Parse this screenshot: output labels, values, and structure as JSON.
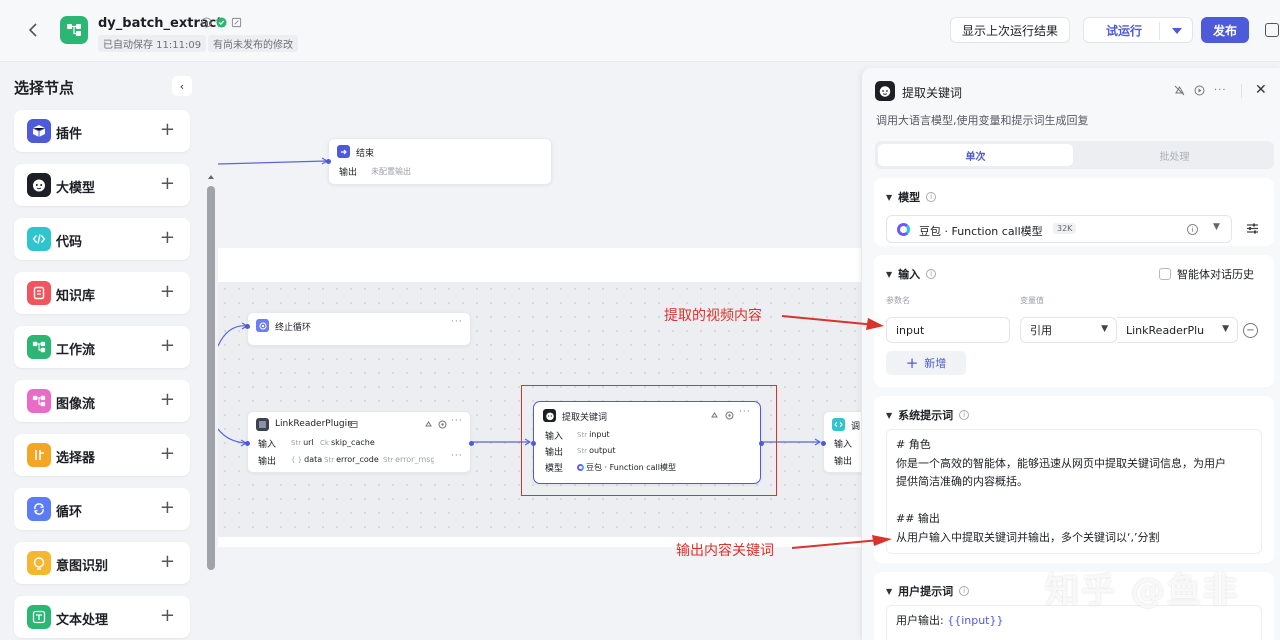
{
  "header": {
    "title": "dy_batch_extract",
    "save_status": "已自动保存 11:11:09",
    "unpublished": "有尚未发布的修改",
    "show_last_run": "显示上次运行结果",
    "test_run": "试运行",
    "publish": "发布"
  },
  "sidebar": {
    "title": "选择节点",
    "items": [
      {
        "label": "插件",
        "color": "#4e5bd8"
      },
      {
        "label": "大模型",
        "color": "#1d1f24"
      },
      {
        "label": "代码",
        "color": "#2ec5ce"
      },
      {
        "label": "知识库",
        "color": "#f0555f"
      },
      {
        "label": "工作流",
        "color": "#2bb673"
      },
      {
        "label": "图像流",
        "color": "#e86bc6"
      },
      {
        "label": "选择器",
        "color": "#f5a524"
      },
      {
        "label": "循环",
        "color": "#5b7cf6"
      },
      {
        "label": "意图识别",
        "color": "#f5b731"
      },
      {
        "label": "文本处理",
        "color": "#2bb673"
      }
    ]
  },
  "canvas": {
    "end_node": {
      "title": "结束",
      "output_label": "输出",
      "output_value": "未配置输出"
    },
    "stop_loop_node": {
      "title": "终止循环"
    },
    "plugin_node": {
      "title": "LinkReaderPlugin",
      "input_label": "输入",
      "output_label": "输出",
      "inputs": [
        {
          "type": "Str",
          "name": "url"
        },
        {
          "type": "Ck",
          "name": "skip_cache"
        }
      ],
      "outputs": [
        {
          "type": "{ }",
          "name": "data"
        },
        {
          "type": "Str",
          "name": "error_code"
        },
        {
          "type": "Str",
          "name": "error_msg"
        }
      ]
    },
    "llm_node": {
      "title": "提取关键词",
      "input_label": "输入",
      "output_label": "输出",
      "model_label": "模型",
      "input_tag": {
        "type": "Str",
        "name": "input"
      },
      "output_tag": {
        "type": "Str",
        "name": "output"
      },
      "model": "豆包 · Function call模型"
    },
    "code_node": {
      "title": "调",
      "input_label": "输入",
      "output_label": "输出"
    }
  },
  "panel": {
    "title": "提取关键词",
    "description": "调用大语言模型,使用变量和提示词生成回复",
    "tabs": {
      "single": "单次",
      "batch": "批处理"
    },
    "model_section": {
      "title": "模型",
      "model_name": "豆包 · Function call模型",
      "context": "32K"
    },
    "input_section": {
      "title": "输入",
      "history_label": "智能体对话历史",
      "param_col": "参数名",
      "value_col": "变量值",
      "param_name": "input",
      "value_type": "引用",
      "value_ref": "LinkReaderPlu",
      "add_label": "新增"
    },
    "system_prompt": {
      "title": "系统提示词",
      "lines": [
        "# 角色",
        "你是一个高效的智能体，能够迅速从网页中提取关键词信息，为用户",
        "提供简洁准确的内容概括。",
        "",
        "## 输出",
        "从用户输入中提取关键词并输出，多个关键词以‘,’分割"
      ]
    },
    "user_prompt": {
      "title": "用户提示词",
      "prefix": "用户输出: ",
      "variable": "{{input}}"
    }
  },
  "annotations": {
    "video_content": "提取的视频内容",
    "output_keywords": "输出内容关键词"
  },
  "watermark": "知乎 @鱼非"
}
